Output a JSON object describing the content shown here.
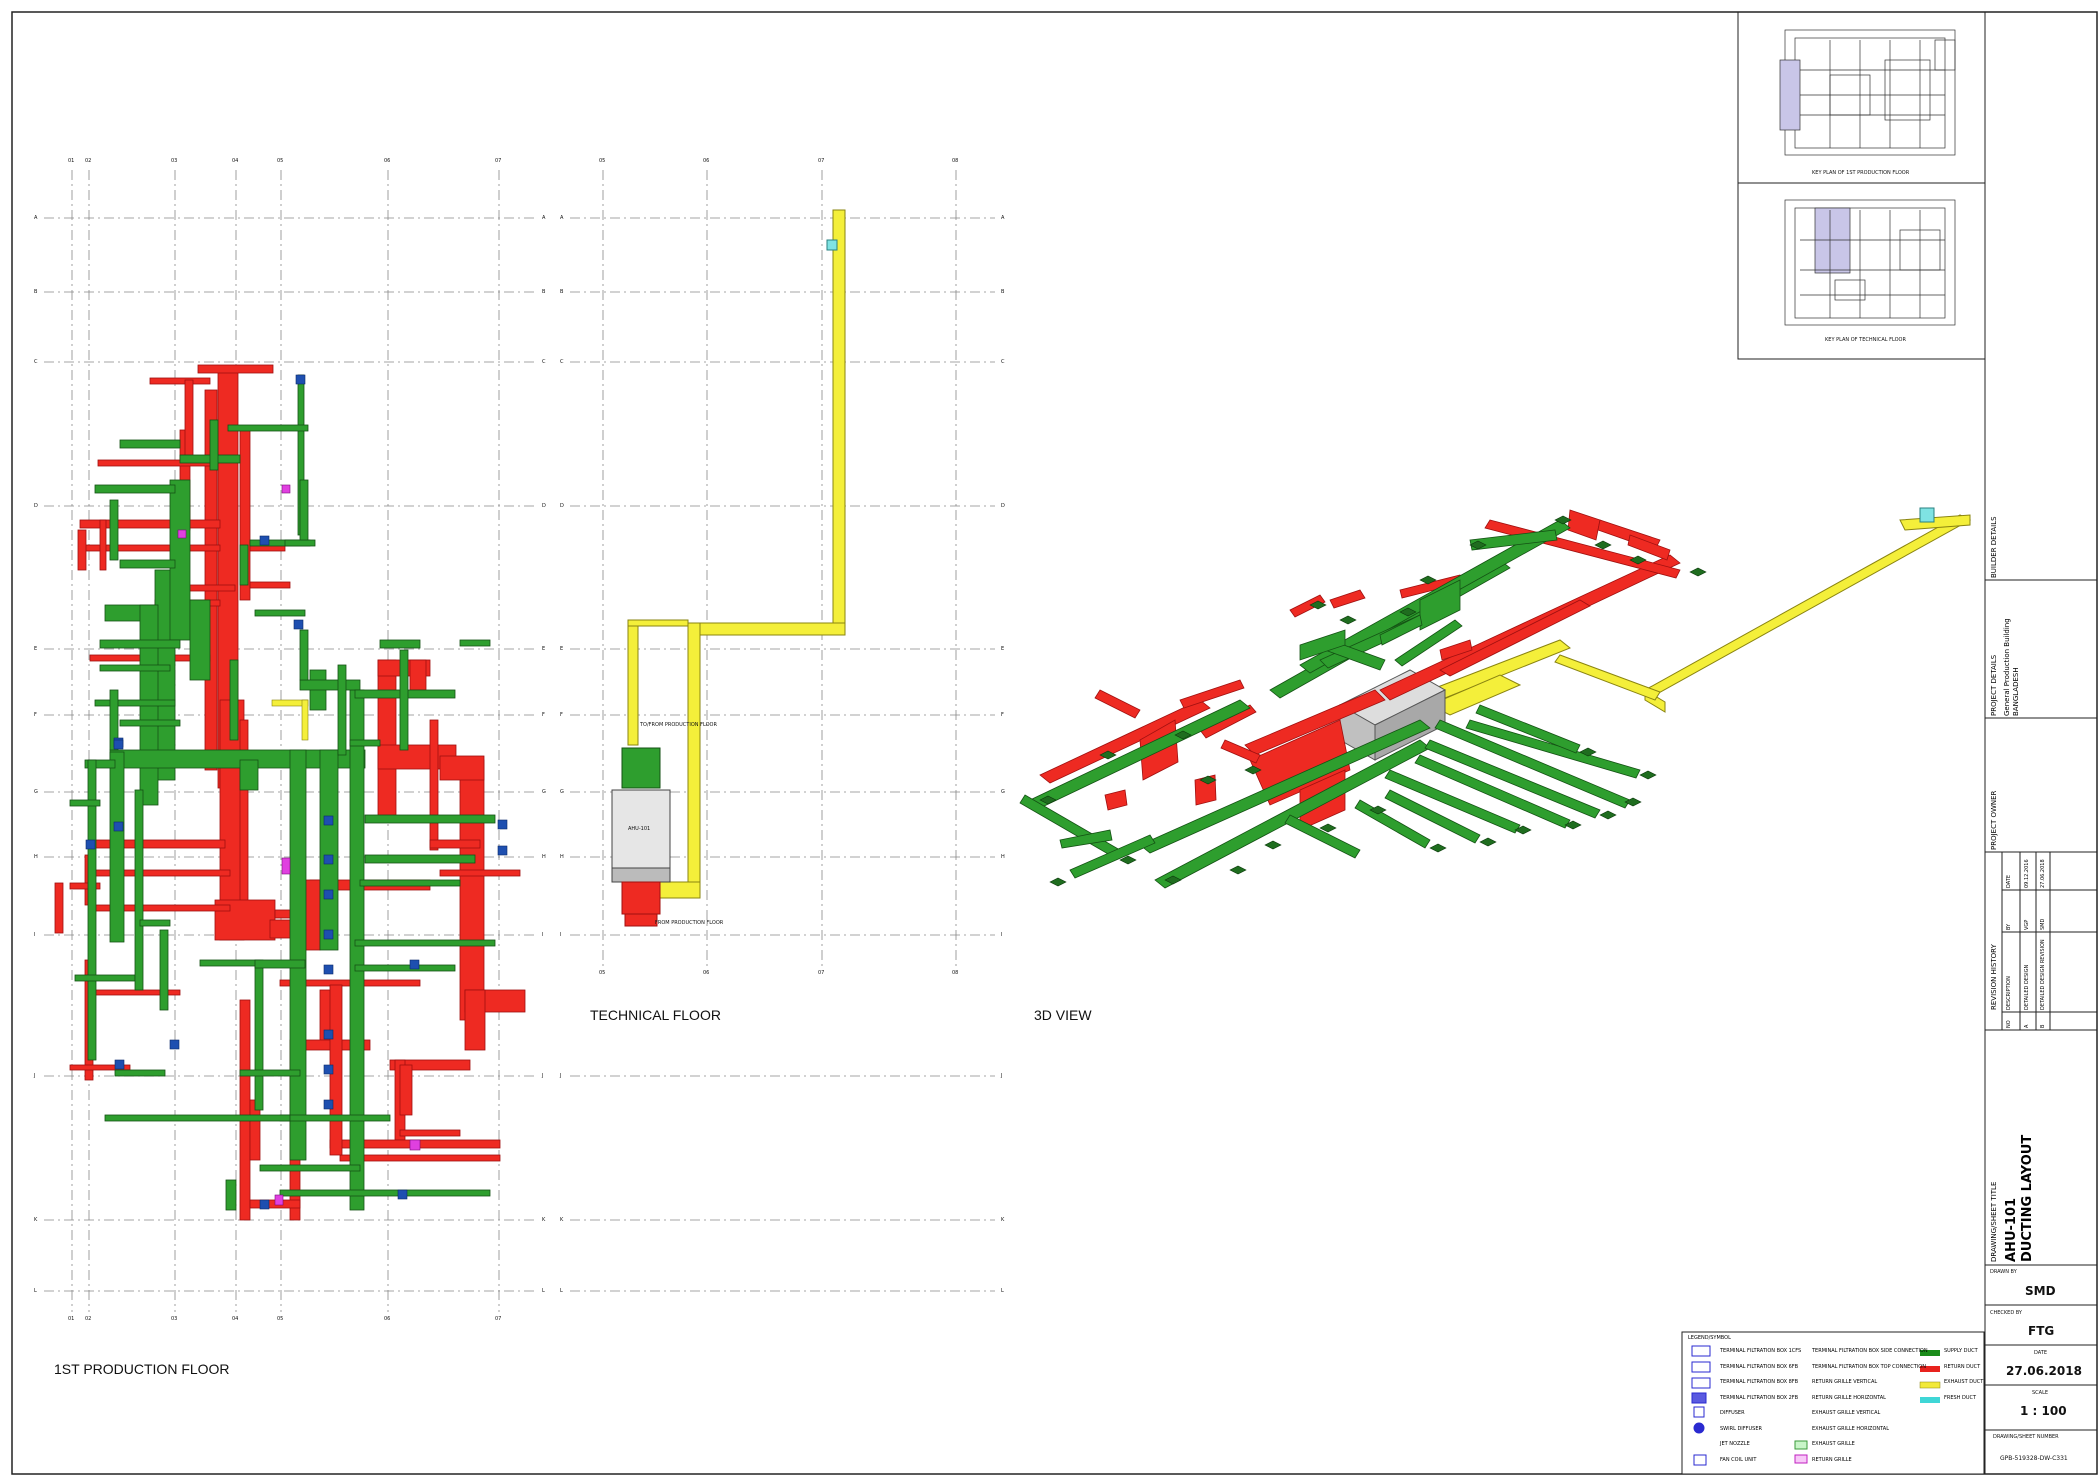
{
  "views": {
    "floor1_title": "1ST PRODUCTION FLOOR",
    "technical_title": "TECHNICAL FLOOR",
    "view3d_title": "3D  VIEW"
  },
  "grid": {
    "cols_floor1": [
      "01",
      "02",
      "03",
      "04",
      "05",
      "06",
      "07"
    ],
    "cols_technical": [
      "05",
      "06",
      "07",
      "08"
    ],
    "rows": [
      "A",
      "B",
      "C",
      "D",
      "E",
      "F",
      "G",
      "H",
      "I",
      "J",
      "K",
      "L"
    ]
  },
  "technical_notes": {
    "to_production": "TO/FROM PRODUCTION FLOOR",
    "from_production": "FROM PRODUCTION FLOOR",
    "ahu": "AHU-101"
  },
  "keyplans": {
    "plan1_caption": "KEY PLAN OF 1ST PRODUCTION FLOOR",
    "plan2_caption": "KEY PLAN OF TECHNICAL FLOOR"
  },
  "titleblock": {
    "builder_details": "BUILDER DETAILS",
    "project_details": "PROJECT DETAILS",
    "project_name": "General Production Building",
    "project_location": "BANGLADESH",
    "project_owner": "PROJECT OWNER",
    "revision_history": "REVISION HISTORY",
    "rev_headers": [
      "NO",
      "DESCRIPTION",
      "BY",
      "DATE"
    ],
    "revisions": [
      {
        "no": "A",
        "description": "DETAILED DESIGN",
        "by": "VGP",
        "date": "09.12.2016"
      },
      {
        "no": "B",
        "description": "DETAILED DESIGN REVISION",
        "by": "SMD",
        "date": "27.06.2018"
      }
    ],
    "sheet_title_label": "DRAWING/SHEET TITLE",
    "sheet_title_1": "AHU-101",
    "sheet_title_2": "DUCTING LAYOUT",
    "drawn_by_label": "DRAWN BY",
    "drawn_by": "SMD",
    "checked_by_label": "CHECKED BY",
    "checked_by": "FTG",
    "date_label": "DATE",
    "date": "27.06.2018",
    "scale_label": "SCALE",
    "scale": "1 : 100",
    "sheet_number_label": "DRAWING/SHEET NUMBER",
    "sheet_number": "GPB-519328-DW-C331"
  },
  "legend": {
    "title": "LEGEND/SYMBOL",
    "col1": [
      "TERMINAL FILTRATION BOX 1CFS",
      "TERMINAL FILTRATION BOX 6FB",
      "TERMINAL FILTRATION BOX 8FB",
      "TERMINAL FILTRATION BOX 2FB",
      "DIFFUSER",
      "SWIRL DIFFUSER",
      "JET NOZZLE",
      "FAN COIL UNIT"
    ],
    "col2": [
      "TERMINAL FILTRATION BOX SIDE CONNECTION",
      "TERMINAL FILTRATION BOX TOP CONNECTION",
      "RETURN GRILLE VERTICAL",
      "RETURN GRILLE HORIZONTAL",
      "EXHAUST GRILLE VERTICAL",
      "EXHAUST GRILLE HORIZONTAL",
      "EXHAUST GRILLE",
      "RETURN GRILLE"
    ],
    "col3": [
      {
        "label": "SUPPLY DUCT",
        "color": "#1a8c1a"
      },
      {
        "label": "RETURN DUCT",
        "color": "#e8231e"
      },
      {
        "label": "EXHAUST DUCT",
        "color": "#f2e93a"
      },
      {
        "label": "FRESH DUCT",
        "color": "#3fd6d6"
      }
    ]
  },
  "colors": {
    "supply": "#2e9e2e",
    "supply_dark": "#1f6d1f",
    "return": "#ee2a22",
    "exhaust": "#f4ef3a",
    "fresh": "#7fe3e3",
    "terminal_box": "#1e4fb0",
    "grille": "#e040e0"
  }
}
